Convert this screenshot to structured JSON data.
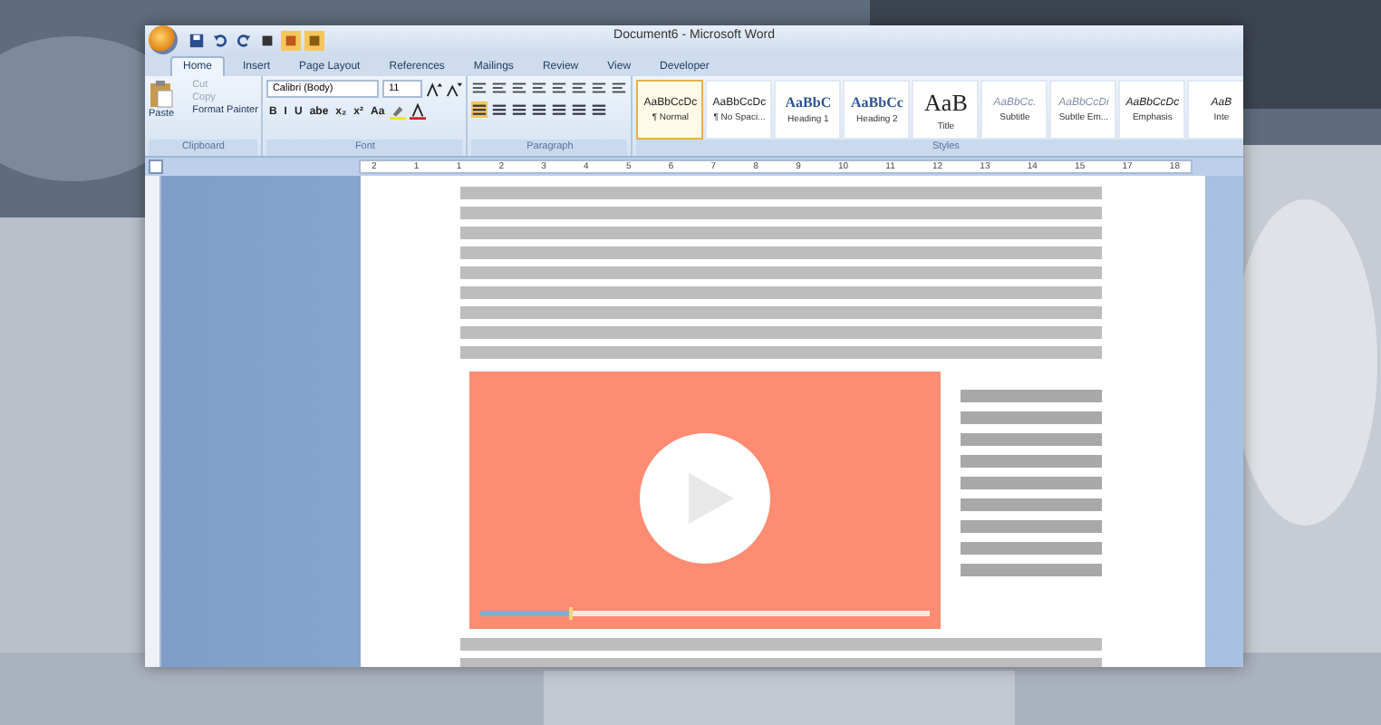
{
  "window": {
    "title": "Document6 - Microsoft Word"
  },
  "tabs": [
    {
      "label": "Home",
      "selected": true
    },
    {
      "label": "Insert",
      "selected": false
    },
    {
      "label": "Page Layout",
      "selected": false
    },
    {
      "label": "References",
      "selected": false
    },
    {
      "label": "Mailings",
      "selected": false
    },
    {
      "label": "Review",
      "selected": false
    },
    {
      "label": "View",
      "selected": false
    },
    {
      "label": "Developer",
      "selected": false
    }
  ],
  "clipboard": {
    "label": "Clipboard",
    "paste": "Paste",
    "items": [
      {
        "label": "Cut",
        "disabled": true
      },
      {
        "label": "Copy",
        "disabled": true
      },
      {
        "label": "Format Painter",
        "disabled": false
      }
    ]
  },
  "font": {
    "label": "Font",
    "family": "Calibri (Body)",
    "size": "11",
    "buttons": [
      "B",
      "I",
      "U",
      "abe",
      "x₂",
      "x²",
      "Aa"
    ]
  },
  "paragraph": {
    "label": "Paragraph"
  },
  "styles": {
    "label": "Styles",
    "items": [
      {
        "preview": "AaBbCcDc",
        "name": "¶ Normal",
        "selected": true,
        "kind": "body"
      },
      {
        "preview": "AaBbCcDc",
        "name": "¶ No Spaci...",
        "selected": false,
        "kind": "body"
      },
      {
        "preview": "AaBbC",
        "name": "Heading 1",
        "selected": false,
        "kind": "heading"
      },
      {
        "preview": "AaBbCc",
        "name": "Heading 2",
        "selected": false,
        "kind": "heading"
      },
      {
        "preview": "AaB",
        "name": "Title",
        "selected": false,
        "kind": "title"
      },
      {
        "preview": "AaBbCc.",
        "name": "Subtitle",
        "selected": false,
        "kind": "subtle"
      },
      {
        "preview": "AaBbCcDi",
        "name": "Subtle Em...",
        "selected": false,
        "kind": "subtle"
      },
      {
        "preview": "AaBbCcDc",
        "name": "Emphasis",
        "selected": false,
        "kind": "emphasis"
      },
      {
        "preview": "AaB",
        "name": "Inte",
        "selected": false,
        "kind": "emphasis"
      }
    ]
  },
  "ruler_labels": [
    "2",
    "1",
    "1",
    "2",
    "3",
    "4",
    "5",
    "6",
    "7",
    "8",
    "9",
    "10",
    "11",
    "12",
    "13",
    "14",
    "15",
    "17",
    "18"
  ],
  "document": {
    "video": {
      "level": 0.2
    }
  }
}
